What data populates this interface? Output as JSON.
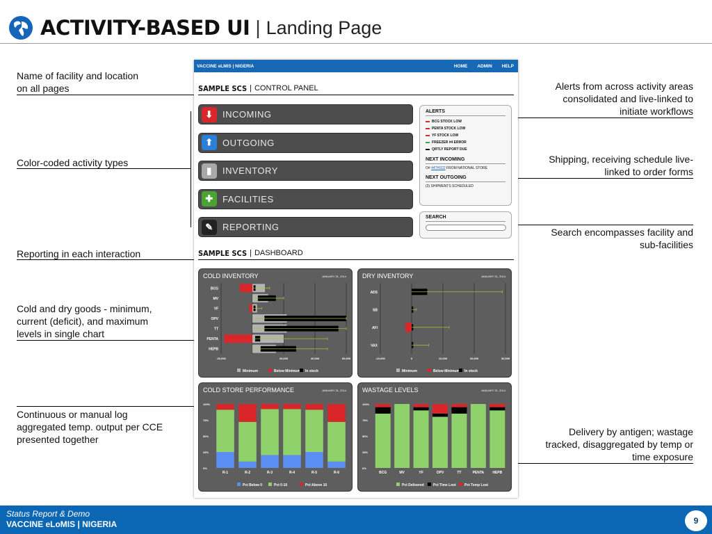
{
  "title": {
    "main": "ACTIVITY-BASED UI",
    "separator": "|",
    "sub": "Landing Page"
  },
  "annotations": {
    "facility": "Name of facility and location\non all pages",
    "color_coded": "Color-coded activity types",
    "reporting": "Reporting in each interaction",
    "cold_dry": "Cold and dry goods - minimum,\ncurrent (deficit), and maximum\nlevels in single chart",
    "log": "Continuous or manual log\naggregated temp. output per CCE\npresented together",
    "alerts": "Alerts from across activity areas\nconsolidated and live-linked to\ninitiate workflows",
    "shipping": "Shipping, receiving schedule live-\nlinked to order forms",
    "search": "Search encompasses facility and\nsub-facilities",
    "delivery": "Delivery by antigen; wastage\ntracked, disaggregated by temp or\ntime exposure"
  },
  "app": {
    "brand": "VACCINE eLMIS | NIGERIA",
    "nav": [
      "HOME",
      "ADMIN",
      "HELP"
    ],
    "control_head": {
      "bold": "SAMPLE SCS",
      "sep": "|",
      "text": "CONTROL PANEL"
    },
    "dash_head": {
      "bold": "SAMPLE SCS",
      "sep": "|",
      "text": "DASHBOARD"
    },
    "activities": [
      {
        "label": "INCOMING",
        "icon": "down-arrow-icon",
        "glyph": "⬇",
        "color": "#d9262b"
      },
      {
        "label": "OUTGOING",
        "icon": "up-arrow-icon",
        "glyph": "⬆",
        "color": "#2b7fd6"
      },
      {
        "label": "INVENTORY",
        "icon": "bar-chart-icon",
        "glyph": "▮",
        "color": "#a8a8a8"
      },
      {
        "label": "FACILITIES",
        "icon": "cross-icon",
        "glyph": "✚",
        "color": "#4ba334"
      },
      {
        "label": "REPORTING",
        "icon": "pencil-icon",
        "glyph": "✎",
        "color": "#222222"
      }
    ],
    "alerts": {
      "title": "ALERTS",
      "items": [
        {
          "text": "BCG STOCK LOW",
          "color": "#d9262b"
        },
        {
          "text": "PENTA STOCK LOW",
          "color": "#d9262b"
        },
        {
          "text": "YF STOCK LOW",
          "color": "#d9262b"
        },
        {
          "text": "FREEZER #4 ERROR",
          "color": "#4ba334"
        },
        {
          "text": "QRTLY REPORT DUE",
          "color": "#111111"
        }
      ],
      "next_incoming_title": "NEXT INCOMING",
      "next_incoming_prefix": "O#",
      "next_incoming_link": "44TH322",
      "next_incoming_suffix": "FROM NATIONAL STORE",
      "next_outgoing_title": "NEXT OUTGOING",
      "next_outgoing_text": "(3) SHIPMENTS SCHEDULED"
    },
    "search": {
      "title": "SEARCH",
      "placeholder": ""
    }
  },
  "chart_data": [
    {
      "type": "bar",
      "title": "COLD INVENTORY",
      "date": "JANUARY 31, 2014",
      "categories": [
        "BCG",
        "MV",
        "YF",
        "OPV",
        "TT",
        "PENTA",
        "HEPB"
      ],
      "xlim": [
        -20000,
        60000
      ],
      "xticks": [
        -20000,
        0,
        20000,
        40000,
        60000
      ],
      "xtick_labels": [
        "-20,000",
        "",
        "20,000",
        "40,000",
        "60,000"
      ],
      "series": [
        {
          "name": "Minimum",
          "color": "#b3b3b3",
          "values": [
            8000,
            10000,
            3000,
            22000,
            22000,
            20000,
            15000
          ]
        },
        {
          "name": "Below Minimum",
          "color": "#d9262b",
          "values": [
            -8000,
            0,
            -2000,
            0,
            0,
            -18000,
            0
          ]
        },
        {
          "name": "In stock",
          "color": "#000000",
          "values": [
            2000,
            15000,
            2000,
            78000,
            55000,
            5000,
            28000
          ]
        }
      ],
      "maximum": [
        11000,
        20000,
        6000,
        80000,
        80000,
        48000,
        48000
      ]
    },
    {
      "type": "bar",
      "title": "DRY INVENTORY",
      "date": "JANUARY 31, 2014",
      "categories": [
        "ADS",
        "SB",
        "AFI",
        "VAX"
      ],
      "xlim": [
        -10000,
        30000
      ],
      "xticks": [
        -10000,
        0,
        10000,
        20000,
        30000
      ],
      "xtick_labels": [
        "-10,000",
        "0",
        "10,000",
        "20,000",
        "30,000"
      ],
      "series": [
        {
          "name": "Minimum",
          "color": "#b3b3b3",
          "values": [
            0,
            0,
            0,
            0
          ]
        },
        {
          "name": "Below Minimum",
          "color": "#d9262b",
          "values": [
            0,
            0,
            -2000,
            0
          ]
        },
        {
          "name": "In stock",
          "color": "#000000",
          "values": [
            5000,
            500,
            500,
            500
          ]
        }
      ],
      "maximum": [
        29000,
        1500,
        12000,
        5500
      ]
    },
    {
      "type": "bar",
      "title": "COLD STORE PERFORMANCE",
      "date": "JANUARY 31, 2014",
      "categories": [
        "R-1",
        "R-2",
        "R-3",
        "R-4",
        "R-5",
        "R-6"
      ],
      "ylim": [
        0,
        100
      ],
      "ytick_labels": [
        "0%",
        "25%",
        "50%",
        "75%",
        "100%"
      ],
      "series": [
        {
          "name": "Pct Below 0",
          "color": "#5b8ef2",
          "values": [
            25,
            10,
            20,
            20,
            25,
            10
          ]
        },
        {
          "name": "Pct 0-10",
          "color": "#8fd16b",
          "values": [
            66,
            62,
            72,
            72,
            66,
            62
          ]
        },
        {
          "name": "Pct Above 10",
          "color": "#d9262b",
          "values": [
            9,
            28,
            8,
            8,
            9,
            28
          ]
        }
      ]
    },
    {
      "type": "bar",
      "title": "WASTAGE LEVELS",
      "date": "JANUARY 31, 2014",
      "categories": [
        "BCG",
        "MV",
        "YF",
        "OPV",
        "TT",
        "PENTA",
        "HEPB"
      ],
      "ylim": [
        0,
        100
      ],
      "ytick_labels": [
        "0%",
        "25%",
        "50%",
        "75%",
        "100%"
      ],
      "series": [
        {
          "name": "Pct Delivered",
          "color": "#8fd16b",
          "values": [
            85,
            100,
            90,
            80,
            85,
            100,
            90
          ]
        },
        {
          "name": "Pct Time Lost",
          "color": "#000000",
          "values": [
            10,
            0,
            5,
            5,
            10,
            0,
            5
          ]
        },
        {
          "name": "Pct Temp Lost",
          "color": "#d9262b",
          "values": [
            5,
            0,
            5,
            15,
            5,
            0,
            5
          ]
        }
      ]
    }
  ],
  "footer": {
    "line1": "Status Report & Demo",
    "line2": "VACCINE eLoMIS | NIGERIA",
    "page": "9"
  }
}
